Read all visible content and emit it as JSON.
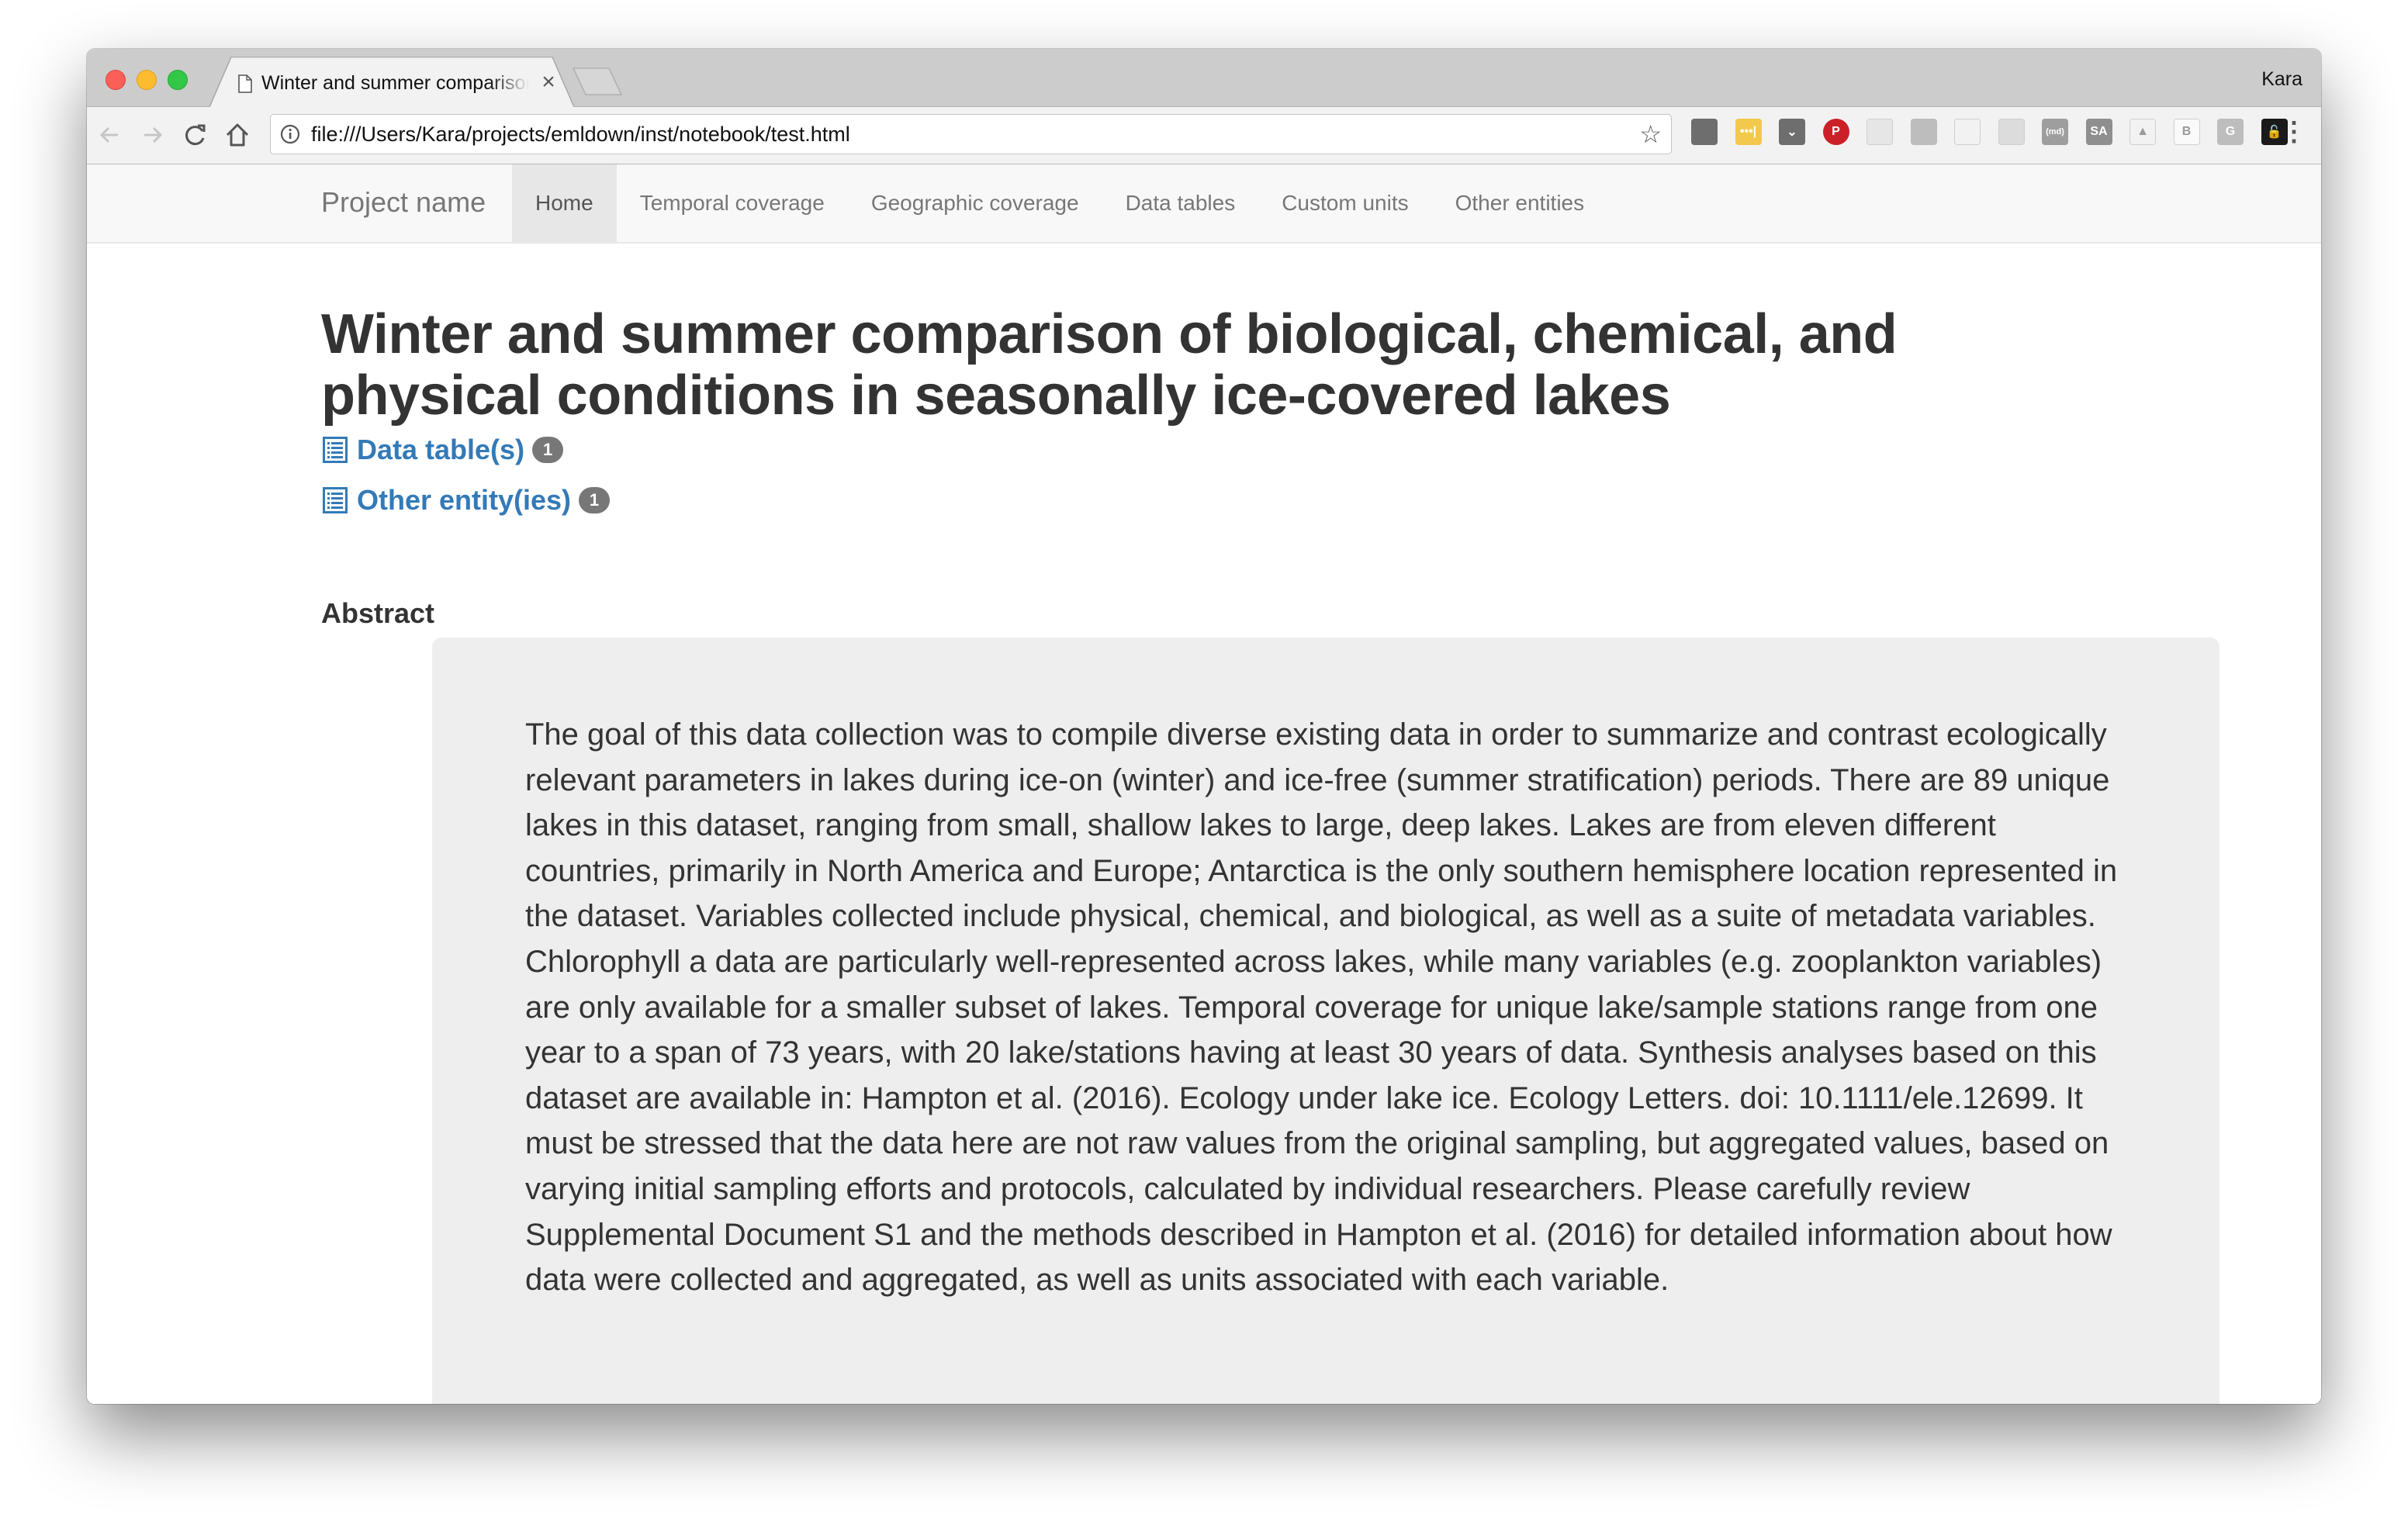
{
  "browser": {
    "tab_title": "Winter and summer comparison of biological, chemical, and physical conditions in seasonally ice-covered lakes",
    "tab_close": "×",
    "profile_name": "Kara",
    "url": "file:///Users/Kara/projects/emldown/inst/notebook/test.html",
    "star": "☆",
    "nav_icons": [
      "back-icon",
      "forward-icon",
      "reload-icon",
      "home-icon"
    ],
    "extensions": [
      {
        "name": "shield-extension-icon",
        "label": "",
        "color": "#6e6e6e"
      },
      {
        "name": "lastpass-extension-icon",
        "label": "•••|",
        "color": "#f2c94c"
      },
      {
        "name": "pocket-extension-icon",
        "label": "⌄",
        "color": "#6e6e6e"
      },
      {
        "name": "pinterest-extension-icon",
        "label": "P",
        "color": "#cb2027"
      },
      {
        "name": "document-extension-icon",
        "label": "",
        "color": "#e6e6e6"
      },
      {
        "name": "outlet-extension-icon",
        "label": "",
        "color": "#bdbdbd"
      },
      {
        "name": "privacy-badger-extension-icon",
        "label": "",
        "color": "#f2f2f2"
      },
      {
        "name": "pin-extension-icon",
        "label": "",
        "color": "#dcdcdc"
      },
      {
        "name": "markdown-extension-icon",
        "label": "(md)",
        "color": "#9e9e9e"
      },
      {
        "name": "sa-extension-icon",
        "label": "SA",
        "color": "#8f8f8f"
      },
      {
        "name": "drive-extension-icon",
        "label": "▲",
        "color": "#f2f2f2"
      },
      {
        "name": "b-extension-icon",
        "label": "B",
        "color": "#fafafa"
      },
      {
        "name": "g-extension-icon",
        "label": "G",
        "color": "#bdbdbd"
      },
      {
        "name": "lock-extension-icon",
        "label": "🔓",
        "color": "#1a1a1a"
      }
    ],
    "menu": "⋮"
  },
  "navbar": {
    "brand": "Project name",
    "links": [
      {
        "label": "Home",
        "active": true
      },
      {
        "label": "Temporal coverage",
        "active": false
      },
      {
        "label": "Geographic coverage",
        "active": false
      },
      {
        "label": "Data tables",
        "active": false
      },
      {
        "label": "Custom units",
        "active": false
      },
      {
        "label": "Other entities",
        "active": false
      }
    ]
  },
  "page": {
    "title": "Winter and summer comparison of biological, chemical, and physical conditions in seasonally ice-covered lakes",
    "links": [
      {
        "label": "Data table(s)",
        "count": "1",
        "icon": "list-icon"
      },
      {
        "label": "Other entity(ies)",
        "count": "1",
        "icon": "list-icon"
      }
    ],
    "abstract_heading": "Abstract",
    "abstract": "The goal of this data collection was to compile diverse existing data in order to summarize and contrast ecologically relevant parameters in lakes during ice-on (winter) and ice-free (summer stratification) periods. There are 89 unique lakes in this dataset, ranging from small, shallow lakes to large, deep lakes. Lakes are from eleven different countries, primarily in North America and Europe; Antarctica is the only southern hemisphere location represented in the dataset. Variables collected include physical, chemical, and biological, as well as a suite of metadata variables. Chlorophyll a data are particularly well-represented across lakes, while many variables (e.g. zooplankton variables) are only available for a smaller subset of lakes. Temporal coverage for unique lake/sample stations range from one year to a span of 73 years, with 20 lake/stations having at least 30 years of data. Synthesis analyses based on this dataset are available in: Hampton et al. (2016). Ecology under lake ice. Ecology Letters. doi: 10.1111/ele.12699. It must be stressed that the data here are not raw values from the original sampling, but aggregated values, based on varying initial sampling efforts and protocols, calculated by individual researchers. Please carefully review Supplemental Document S1 and the methods described in Hampton et al. (2016) for detailed information about how data were collected and aggregated, as well as units associated with each variable."
  },
  "colors": {
    "link": "#337ab7",
    "badge": "#777777",
    "navbar_bg": "#f8f8f8",
    "navbar_active": "#e7e7e7",
    "abstract_bg": "#eeeeee"
  }
}
